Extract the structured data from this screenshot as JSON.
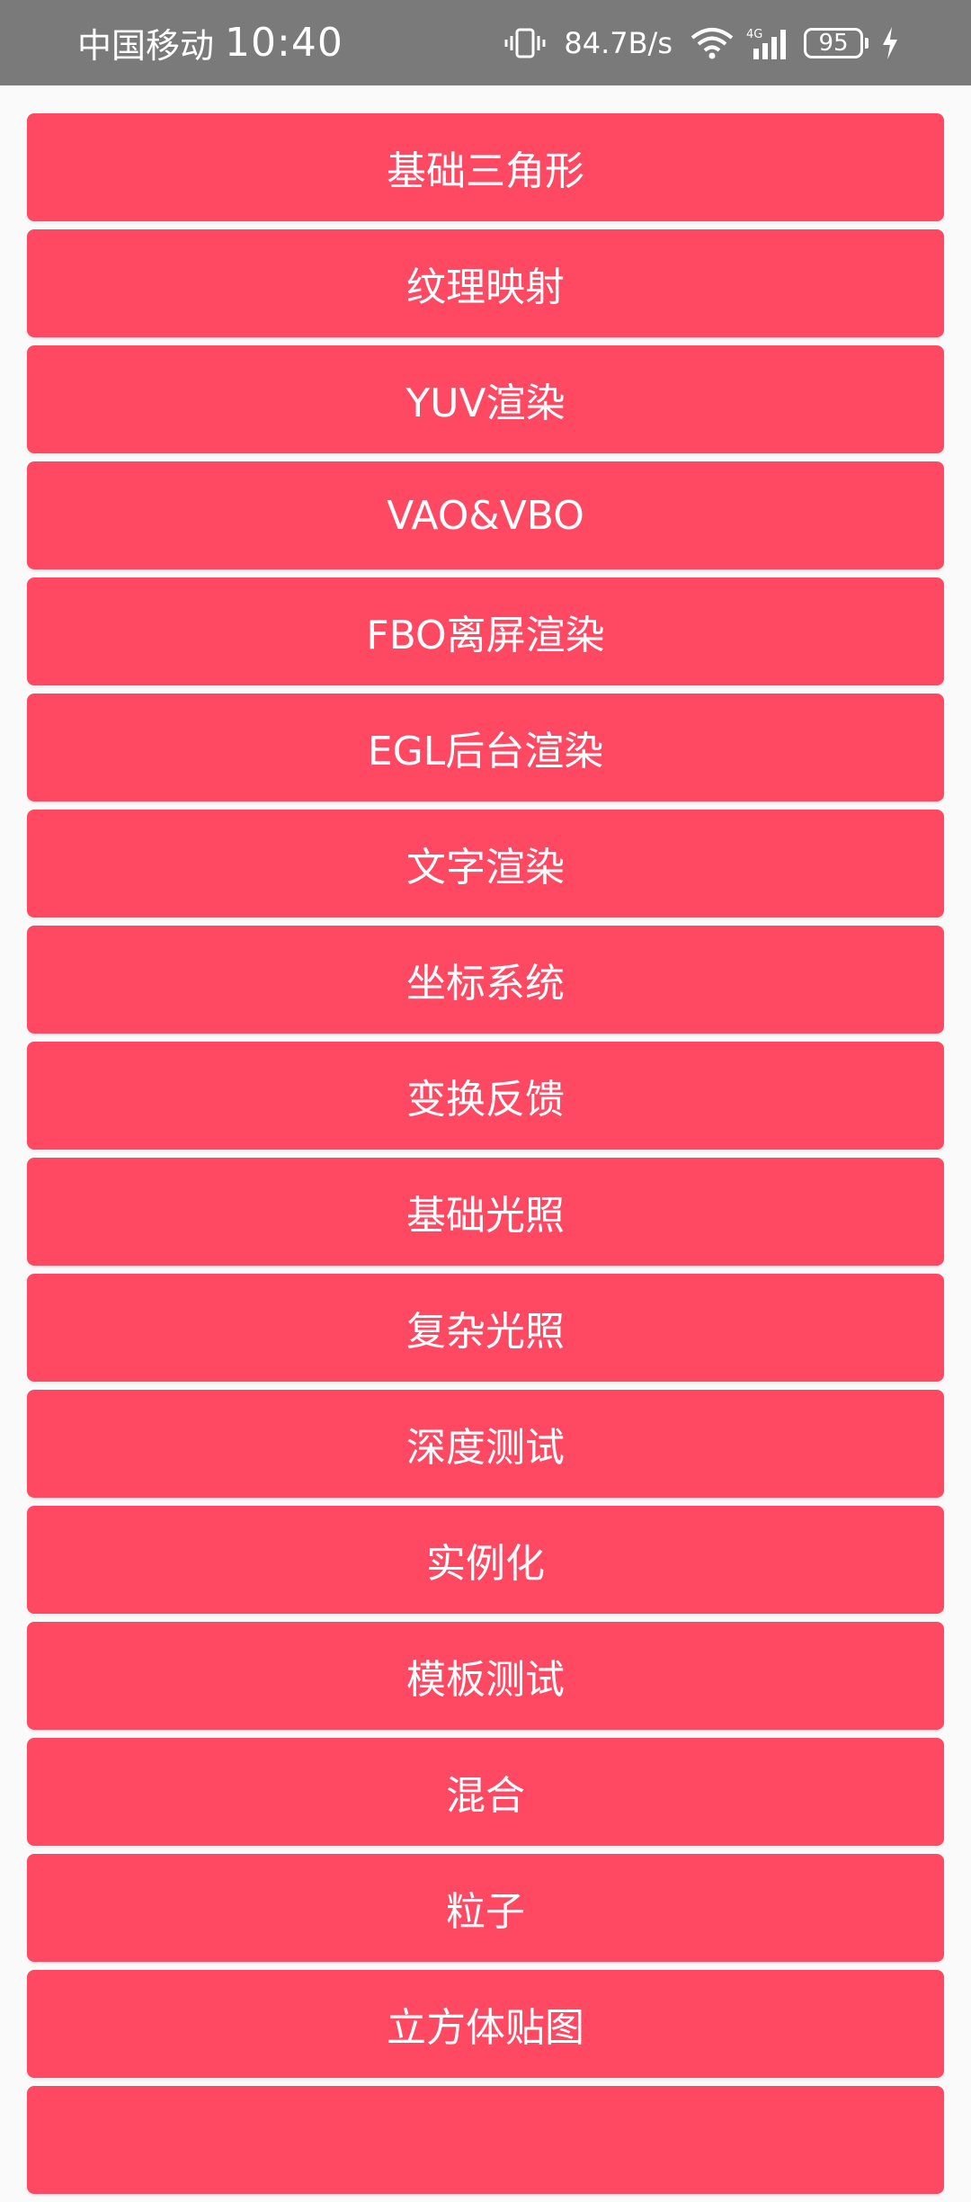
{
  "status_bar": {
    "carrier": "中国移动",
    "time": "10:40",
    "net_speed": "84.7B/s",
    "network_type": "4G",
    "battery_level": "95",
    "icons": [
      "vibrate-icon",
      "wifi-icon",
      "signal-icon",
      "battery-icon",
      "charging-icon"
    ]
  },
  "colors": {
    "accent": "#ff4862",
    "status_bar_bg": "#7a7a7a",
    "page_bg": "#fafafa"
  },
  "buttons": [
    "基础三角形",
    "纹理映射",
    "YUV渲染",
    "VAO&VBO",
    "FBO离屏渲染",
    "EGL后台渲染",
    "文字渲染",
    "坐标系统",
    "变换反馈",
    "基础光照",
    "复杂光照",
    "深度测试",
    "实例化",
    "模板测试",
    "混合",
    "粒子",
    "立方体贴图",
    ""
  ]
}
